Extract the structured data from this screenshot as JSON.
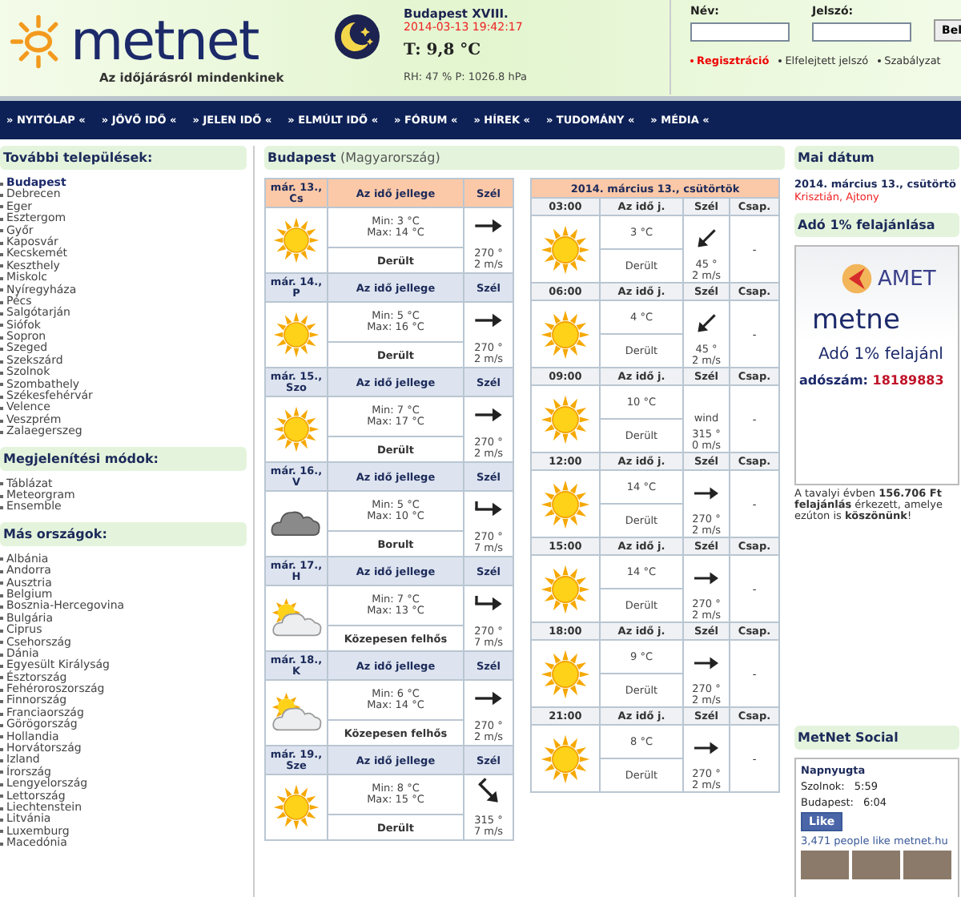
{
  "header": {
    "logo": "metnet",
    "tagline": "Az időjárásról mindenkinek",
    "station": "Budapest XVIII.",
    "timestamp": "2014-03-13 19:42:17",
    "temperature": "T: 9,8 °C",
    "humidity_pressure": "RH: 47 % P: 1026.8 hPa"
  },
  "login": {
    "name_label": "Név:",
    "password_label": "Jelszó:",
    "button": "Bel",
    "links": [
      {
        "label": "Regisztráció",
        "kind": "primary"
      },
      {
        "label": "Elfelejtett jelszó",
        "kind": "normal"
      },
      {
        "label": "Szabályzat",
        "kind": "normal"
      }
    ]
  },
  "nav": [
    "» NYITÓLAP «",
    "» JÖVŐ IDŐ «",
    "» JELEN IDŐ «",
    "» ELMÚLT IDŐ «",
    "» FÓRUM «",
    "» HÍREK «",
    "» TUDOMÁNY «",
    "» MÉDIA «"
  ],
  "sidebar": [
    {
      "title": "További települések:",
      "items": [
        {
          "label": "Budapest",
          "selected": true
        },
        {
          "label": "Debrecen",
          "selected": false
        },
        {
          "label": "Eger",
          "selected": false
        },
        {
          "label": "Esztergom",
          "selected": false
        },
        {
          "label": "Győr",
          "selected": false
        },
        {
          "label": "Kaposvár",
          "selected": false
        },
        {
          "label": "Kecskemét",
          "selected": false
        },
        {
          "label": "Keszthely",
          "selected": false
        },
        {
          "label": "Miskolc",
          "selected": false
        },
        {
          "label": "Nyíregyháza",
          "selected": false
        },
        {
          "label": "Pécs",
          "selected": false
        },
        {
          "label": "Salgótarján",
          "selected": false
        },
        {
          "label": "Siófok",
          "selected": false
        },
        {
          "label": "Sopron",
          "selected": false
        },
        {
          "label": "Szeged",
          "selected": false
        },
        {
          "label": "Szekszárd",
          "selected": false
        },
        {
          "label": "Szolnok",
          "selected": false
        },
        {
          "label": "Szombathely",
          "selected": false
        },
        {
          "label": "Székesfehérvár",
          "selected": false
        },
        {
          "label": "Velence",
          "selected": false
        },
        {
          "label": "Veszprém",
          "selected": false
        },
        {
          "label": "Zalaegerszeg",
          "selected": false
        }
      ]
    },
    {
      "title": "Megjelenítési módok:",
      "items": [
        {
          "label": "Táblázat",
          "selected": false
        },
        {
          "label": "Meteorgram",
          "selected": false
        },
        {
          "label": "Ensemble",
          "selected": false
        }
      ]
    },
    {
      "title": "Más országok:",
      "items": [
        {
          "label": "Albánia",
          "selected": false
        },
        {
          "label": "Andorra",
          "selected": false
        },
        {
          "label": "Ausztria",
          "selected": false
        },
        {
          "label": "Belgium",
          "selected": false
        },
        {
          "label": "Bosznia-Hercegovina",
          "selected": false
        },
        {
          "label": "Bulgária",
          "selected": false
        },
        {
          "label": "Ciprus",
          "selected": false
        },
        {
          "label": "Csehország",
          "selected": false
        },
        {
          "label": "Dánia",
          "selected": false
        },
        {
          "label": "Egyesült Királyság",
          "selected": false
        },
        {
          "label": "Észtország",
          "selected": false
        },
        {
          "label": "Fehéroroszország",
          "selected": false
        },
        {
          "label": "Finnország",
          "selected": false
        },
        {
          "label": "Franciaország",
          "selected": false
        },
        {
          "label": "Görögország",
          "selected": false
        },
        {
          "label": "Hollandia",
          "selected": false
        },
        {
          "label": "Horvátország",
          "selected": false
        },
        {
          "label": "Izland",
          "selected": false
        },
        {
          "label": "Írország",
          "selected": false
        },
        {
          "label": "Lengyelország",
          "selected": false
        },
        {
          "label": "Lettország",
          "selected": false
        },
        {
          "label": "Liechtenstein",
          "selected": false
        },
        {
          "label": "Litvánia",
          "selected": false
        },
        {
          "label": "Luxemburg",
          "selected": false
        },
        {
          "label": "Macedónia",
          "selected": false
        }
      ]
    }
  ],
  "location": {
    "city": "Budapest",
    "country": "(Magyarország)"
  },
  "daily": [
    {
      "date": "már. 13.,",
      "day": "Cs",
      "today": true,
      "col_weather": "Az idő jellege",
      "col_wind": "Szél",
      "kind": "sun",
      "min": "Min: 3 °C",
      "max": "Max: 14 °C",
      "description": "Derült",
      "wind": {
        "kind": "east",
        "feathered": false,
        "direction": "270 °",
        "speed": "2 m/s"
      }
    },
    {
      "date": "már. 14.,",
      "day": "P",
      "today": false,
      "col_weather": "Az idő jellege",
      "col_wind": "Szél",
      "kind": "sun",
      "min": "Min: 5 °C",
      "max": "Max: 16 °C",
      "description": "Derült",
      "wind": {
        "kind": "east",
        "feathered": false,
        "direction": "270 °",
        "speed": "2 m/s"
      }
    },
    {
      "date": "már. 15.,",
      "day": "Szo",
      "today": false,
      "col_weather": "Az idő jellege",
      "col_wind": "Szél",
      "kind": "sun",
      "min": "Min: 7 °C",
      "max": "Max: 17 °C",
      "description": "Derült",
      "wind": {
        "kind": "east",
        "feathered": false,
        "direction": "270 °",
        "speed": "2 m/s"
      }
    },
    {
      "date": "már. 16.,",
      "day": "V",
      "today": false,
      "col_weather": "Az idő jellege",
      "col_wind": "Szél",
      "kind": "cloud",
      "min": "Min: 5 °C",
      "max": "Max: 10 °C",
      "description": "Borult",
      "wind": {
        "kind": "east",
        "feathered": true,
        "direction": "270 °",
        "speed": "7 m/s"
      }
    },
    {
      "date": "már. 17.,",
      "day": "H",
      "today": false,
      "col_weather": "Az idő jellege",
      "col_wind": "Szél",
      "kind": "partly",
      "min": "Min: 7 °C",
      "max": "Max: 13 °C",
      "description": "Közepesen felhős",
      "wind": {
        "kind": "east",
        "feathered": true,
        "direction": "270 °",
        "speed": "7 m/s"
      }
    },
    {
      "date": "már. 18.,",
      "day": "K",
      "today": false,
      "col_weather": "Az idő jellege",
      "col_wind": "Szél",
      "kind": "partly",
      "min": "Min: 6 °C",
      "max": "Max: 14 °C",
      "description": "Közepesen felhős",
      "wind": {
        "kind": "east",
        "feathered": false,
        "direction": "270 °",
        "speed": "2 m/s"
      }
    },
    {
      "date": "már. 19.,",
      "day": "Sze",
      "today": false,
      "col_weather": "Az idő jellege",
      "col_wind": "Szél",
      "kind": "sun",
      "min": "Min: 8 °C",
      "max": "Max: 15 °C",
      "description": "Derült",
      "wind": {
        "kind": "southeast",
        "feathered": true,
        "direction": "315 °",
        "speed": "7 m/s"
      }
    }
  ],
  "hourly": {
    "title": "2014. március 13., csütörtök",
    "rows": [
      {
        "time": "03:00",
        "col_weather": "Az idő j.",
        "col_wind": "Szél",
        "col_precip": "Csap.",
        "kind": "sun",
        "temp": "3 °C",
        "description": "Derült",
        "wind": {
          "kind": "southwest",
          "direction": "45 °",
          "speed": "2 m/s"
        },
        "precip": "-"
      },
      {
        "time": "06:00",
        "col_weather": "Az idő j.",
        "col_wind": "Szél",
        "col_precip": "Csap.",
        "kind": "sun",
        "temp": "4 °C",
        "description": "Derült",
        "wind": {
          "kind": "southwest",
          "direction": "45 °",
          "speed": "2 m/s"
        },
        "precip": "-"
      },
      {
        "time": "09:00",
        "col_weather": "Az idő j.",
        "col_wind": "Szél",
        "col_precip": "Csap.",
        "kind": "sun",
        "temp": "10 °C",
        "description": "Derült",
        "wind": {
          "kind": "text",
          "label": "wind",
          "direction": "315 °",
          "speed": "0 m/s"
        },
        "precip": "-"
      },
      {
        "time": "12:00",
        "col_weather": "Az idő j.",
        "col_wind": "Szél",
        "col_precip": "Csap.",
        "kind": "sun",
        "temp": "14 °C",
        "description": "Derült",
        "wind": {
          "kind": "east",
          "direction": "270 °",
          "speed": "2 m/s"
        },
        "precip": "-"
      },
      {
        "time": "15:00",
        "col_weather": "Az idő j.",
        "col_wind": "Szél",
        "col_precip": "Csap.",
        "kind": "sun",
        "temp": "14 °C",
        "description": "Derült",
        "wind": {
          "kind": "east",
          "direction": "270 °",
          "speed": "2 m/s"
        },
        "precip": "-"
      },
      {
        "time": "18:00",
        "col_weather": "Az idő j.",
        "col_wind": "Szél",
        "col_precip": "Csap.",
        "kind": "sun",
        "temp": "9 °C",
        "description": "Derült",
        "wind": {
          "kind": "east",
          "direction": "270 °",
          "speed": "2 m/s"
        },
        "precip": "-"
      },
      {
        "time": "21:00",
        "col_weather": "Az idő j.",
        "col_wind": "Szél",
        "col_precip": "Csap.",
        "kind": "sun",
        "temp": "8 °C",
        "description": "Derült",
        "wind": {
          "kind": "east",
          "direction": "270 °",
          "speed": "2 m/s"
        },
        "precip": "-"
      }
    ]
  },
  "right": {
    "date_title": "Mai dátum",
    "date": "2014. március 13., csütörtö",
    "namedays": "Krisztián, Ajtony",
    "tax_title": "Adó 1% felajánlása",
    "banner": {
      "brand": "AMET",
      "logo": "metne",
      "headline": "Adó 1% felajánl",
      "tax_label": "adószám:",
      "tax_number": "18189883"
    },
    "thanks": [
      "A tavalyi évben **156.706 Ft**",
      "**felajánlás** érkezett, amelye",
      "ezúton is **köszönünk**!"
    ],
    "social_title": "MetNet Social",
    "social": {
      "heading": "Napnyugta",
      "times": [
        {
          "place": "Szolnok:",
          "time": "5:59"
        },
        {
          "place": "Budapest:",
          "time": "6:04"
        }
      ],
      "like": "Like",
      "likes": "3,471 people like metnet.hu"
    }
  }
}
